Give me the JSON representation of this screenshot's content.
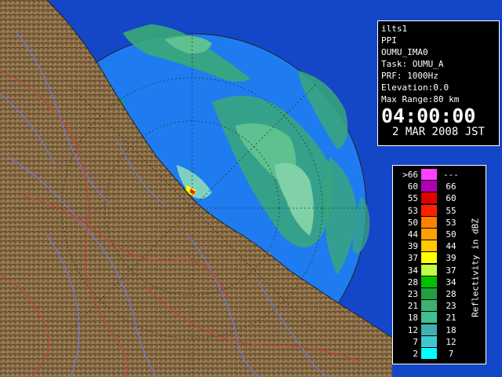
{
  "info": {
    "station": "ilts1",
    "product": "PPI",
    "site": "OUMU_IMA0",
    "task": "Task: OUMU_A",
    "prf": "PRF: 1000Hz",
    "elevation": "Elevation:0.0",
    "max_range": "Max Range:80 km",
    "time": "04:00:00",
    "date": "2 MAR 2008 JST"
  },
  "legend": {
    "unit": "Reflectivity in dBZ",
    "rows": [
      {
        "lo": ">66",
        "hi": "---",
        "color": "#ff40ff"
      },
      {
        "lo": "60",
        "hi": "66",
        "color": "#b000b0"
      },
      {
        "lo": "55",
        "hi": "60",
        "color": "#e00000"
      },
      {
        "lo": "53",
        "hi": "55",
        "color": "#ff2000"
      },
      {
        "lo": "50",
        "hi": "53",
        "color": "#ff8000"
      },
      {
        "lo": "44",
        "hi": "50",
        "color": "#ffa000"
      },
      {
        "lo": "39",
        "hi": "44",
        "color": "#ffc800"
      },
      {
        "lo": "37",
        "hi": "39",
        "color": "#ffff00"
      },
      {
        "lo": "34",
        "hi": "37",
        "color": "#c0ff40"
      },
      {
        "lo": "28",
        "hi": "34",
        "color": "#00c000"
      },
      {
        "lo": "23",
        "hi": "28",
        "color": "#20a040"
      },
      {
        "lo": "21",
        "hi": "23",
        "color": "#40b070"
      },
      {
        "lo": "18",
        "hi": "21",
        "color": "#40c090"
      },
      {
        "lo": "12",
        "hi": "18",
        "color": "#40b0b0"
      },
      {
        "lo": "7",
        "hi": "12",
        "color": "#40c8d0"
      },
      {
        "lo": "2",
        "hi": "7",
        "color": "#00ffff"
      }
    ]
  },
  "colors": {
    "sea_inner": "#1e7cf0",
    "sea_outer": "#1446c8",
    "land": "#8a6e4a",
    "rivers": "#6a78e0",
    "borders": "#c8403c"
  }
}
